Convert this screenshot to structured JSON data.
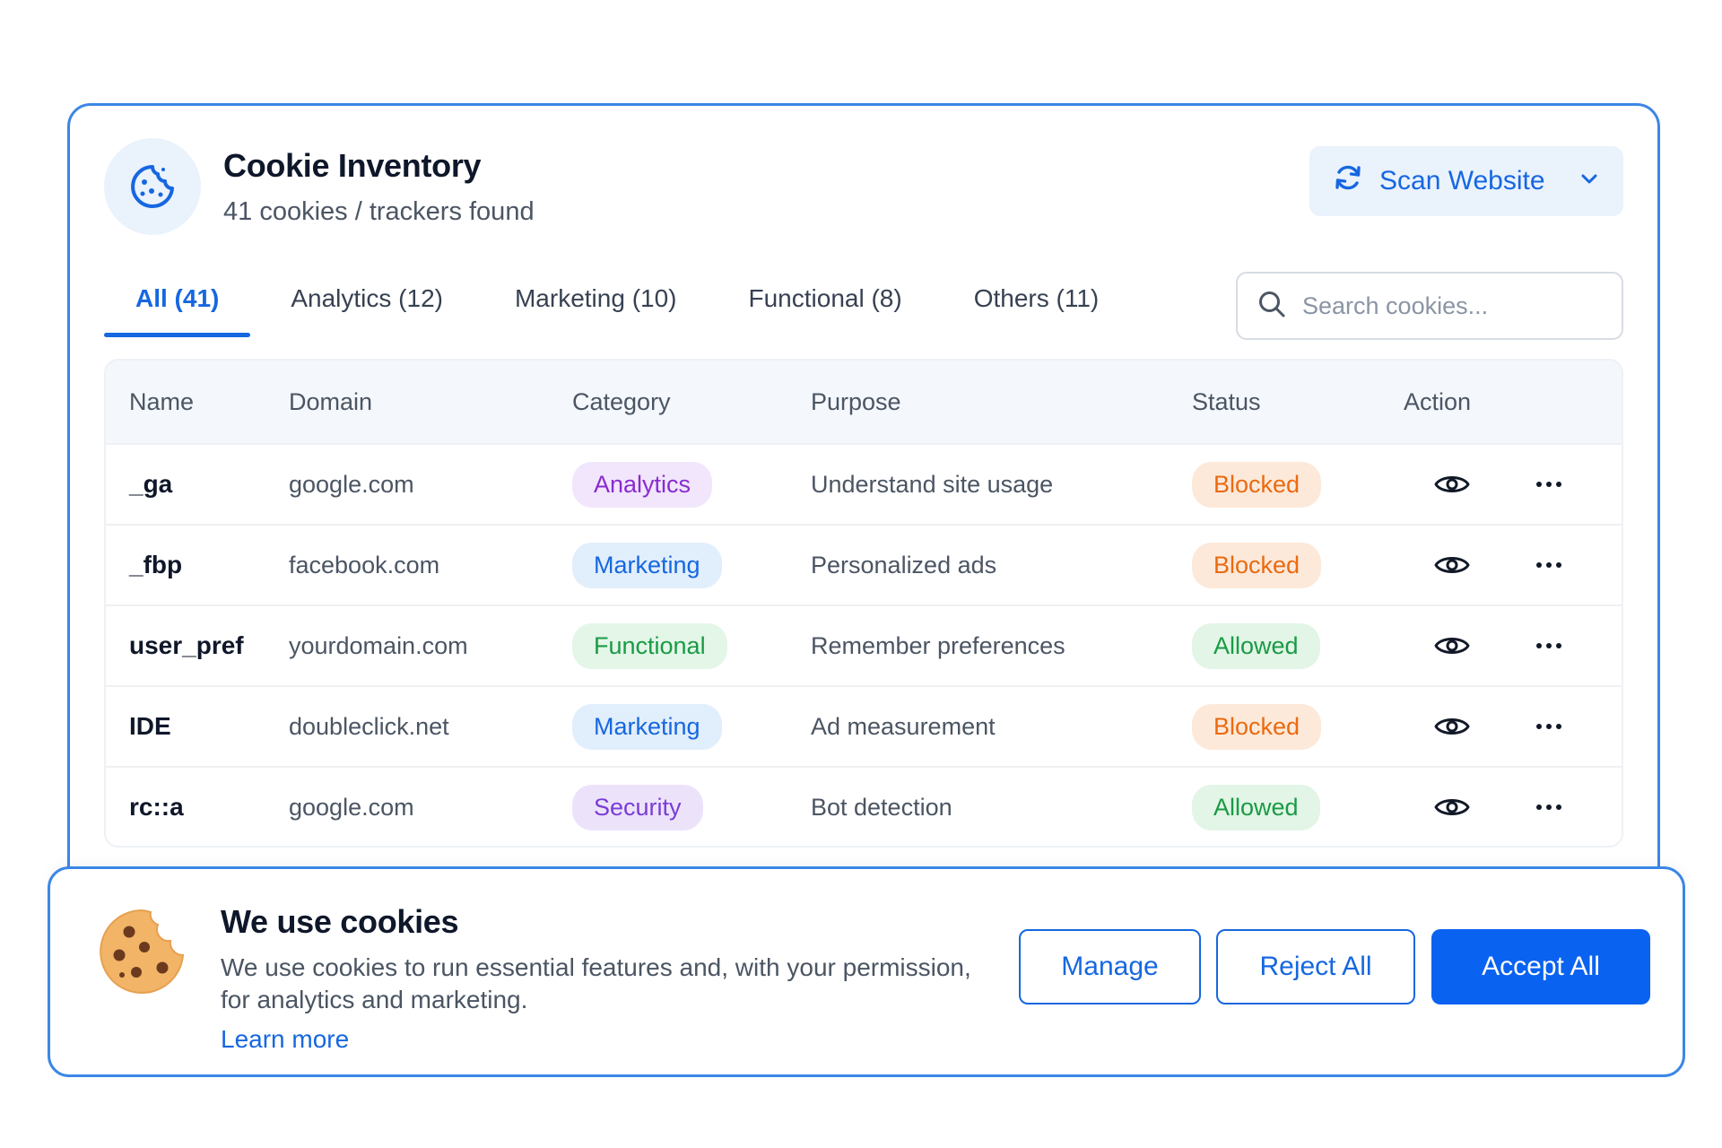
{
  "header": {
    "title": "Cookie Inventory",
    "subtitle": "41 cookies / trackers found",
    "scan_label": "Scan Website"
  },
  "tabs": [
    {
      "label": "All (41)",
      "active": true
    },
    {
      "label": "Analytics (12)",
      "active": false
    },
    {
      "label": "Marketing (10)",
      "active": false
    },
    {
      "label": "Functional (8)",
      "active": false
    },
    {
      "label": "Others (11)",
      "active": false
    }
  ],
  "search": {
    "placeholder": "Search cookies..."
  },
  "table": {
    "columns": [
      "Name",
      "Domain",
      "Category",
      "Purpose",
      "Status",
      "Action"
    ],
    "rows": [
      {
        "name": "_ga",
        "domain": "google.com",
        "category": "Analytics",
        "purpose": "Understand site usage",
        "status": "Blocked"
      },
      {
        "name": "_fbp",
        "domain": "facebook.com",
        "category": "Marketing",
        "purpose": "Personalized ads",
        "status": "Blocked"
      },
      {
        "name": "user_pref",
        "domain": "yourdomain.com",
        "category": "Functional",
        "purpose": "Remember preferences",
        "status": "Allowed"
      },
      {
        "name": "IDE",
        "domain": "doubleclick.net",
        "category": "Marketing",
        "purpose": "Ad measurement",
        "status": "Blocked"
      },
      {
        "name": "rc::a",
        "domain": "google.com",
        "category": "Security",
        "purpose": "Bot detection",
        "status": "Allowed"
      }
    ]
  },
  "banner": {
    "title": "We use cookies",
    "body": "We use cookies to run essential features and, with your permission, for analytics and marketing.",
    "link": "Learn more",
    "manage_label": "Manage",
    "reject_label": "Reject All",
    "accept_label": "Accept All"
  },
  "icons": {
    "header_logo": "cookie-icon",
    "scan": "refresh-icon",
    "scan_menu": "chevron-down-icon",
    "search": "search-icon",
    "row_view": "eye-icon",
    "row_more": "more-horizontal-icon",
    "banner_cookie": "cookie-icon"
  },
  "colors": {
    "accent": "#1667e0",
    "panel_border": "#3b86e6",
    "analytics": "#8a2bd0",
    "marketing": "#1667e0",
    "functional": "#1a9a45",
    "security": "#7a3cd6",
    "blocked": "#ea6a10",
    "allowed": "#1a9a45"
  }
}
